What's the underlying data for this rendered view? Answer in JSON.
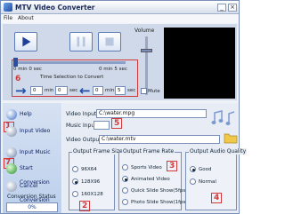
{
  "window": {
    "title": "MTV Video Converter",
    "minimize": "_",
    "close": "×"
  },
  "menu": {
    "items": [
      "File",
      "About"
    ]
  },
  "player": {
    "volume_label": "Volume",
    "position_start": "0 min 0 sec",
    "position_end": "0 min 5 sec",
    "time_selection_label": "Time Selection to Convert",
    "from_min": "0",
    "from_min_unit": "min",
    "from_sec": "0",
    "from_sec_unit": "sec",
    "to_min": "0",
    "to_min_unit": "min",
    "to_sec": "5",
    "to_sec_unit": "sec",
    "mute_label": "Mute"
  },
  "sidebar": {
    "items": [
      {
        "label": "Help"
      },
      {
        "label": "Input Video"
      },
      {
        "label": "Input Music"
      },
      {
        "label": "Start Conversion"
      },
      {
        "label": "Cancel Conversion"
      }
    ],
    "status_label": "Conversion Status",
    "status_value": "0%"
  },
  "form": {
    "video_input_label": "Video Input",
    "video_input_value": "C:\\water.mpg",
    "music_input_label": "Music Input",
    "music_input_value": "",
    "video_output_label": "Video Output",
    "video_output_value": "C:\\water.mtv"
  },
  "groups": {
    "frame_size": {
      "title": "Output Frame Size",
      "options": [
        "96X64",
        "128X96",
        "160X128"
      ],
      "selected": 1
    },
    "frame_rate": {
      "title": "Output Frame Rate",
      "options": [
        "Sports Video",
        "Animated Video",
        "Quick Slide Show(5fps)",
        "Photo Slide Show(1fps)"
      ],
      "selected": 1
    },
    "audio_quality": {
      "title": "Output Audio Quality",
      "options": [
        "Good",
        "Normal"
      ],
      "selected": 0
    }
  },
  "annotations": [
    "1",
    "2",
    "3",
    "4",
    "5",
    "6",
    "7"
  ],
  "colors": {
    "annotation": "#d23a3a",
    "accent": "#1f4fa8"
  }
}
